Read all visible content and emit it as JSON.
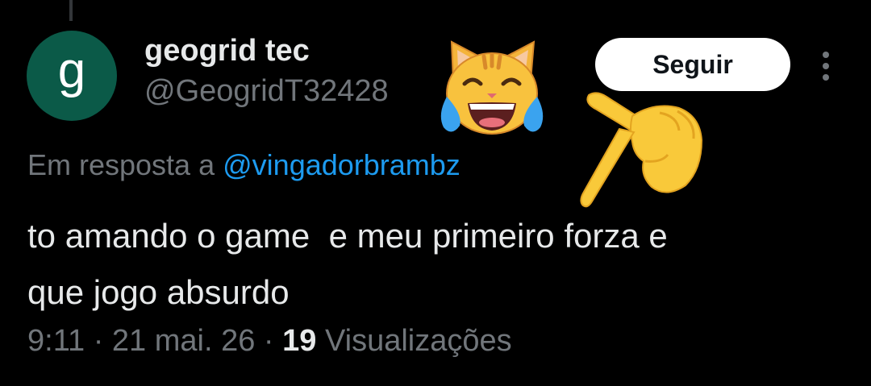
{
  "user": {
    "avatar_letter": "g",
    "display_name": "geogrid tec",
    "handle": "@GeogridT32428"
  },
  "actions": {
    "follow_label": "Seguir",
    "more_icon": "more-vertical-icon"
  },
  "emojis": {
    "cat": "cat-face-with-tears-of-joy-emoji",
    "pointer": "backhand-index-pointing-down-emoji"
  },
  "reply": {
    "prefix": "Em resposta a",
    "mention": "@vingadorbrambz"
  },
  "tweet": {
    "text": "to amando o game  e meu primeiro forza e\nque jogo absurdo"
  },
  "meta": {
    "time": "9:11",
    "sep1": " · ",
    "date": "21 mai. 26",
    "sep2": " · ",
    "views_count": "19",
    "views_label": " Visualizações"
  },
  "colors": {
    "background": "#000000",
    "text_primary": "#e7e9ea",
    "text_secondary": "#71767b",
    "link": "#1d9bf0",
    "avatar_bg": "#0b5a48",
    "button_bg": "#ffffff"
  }
}
